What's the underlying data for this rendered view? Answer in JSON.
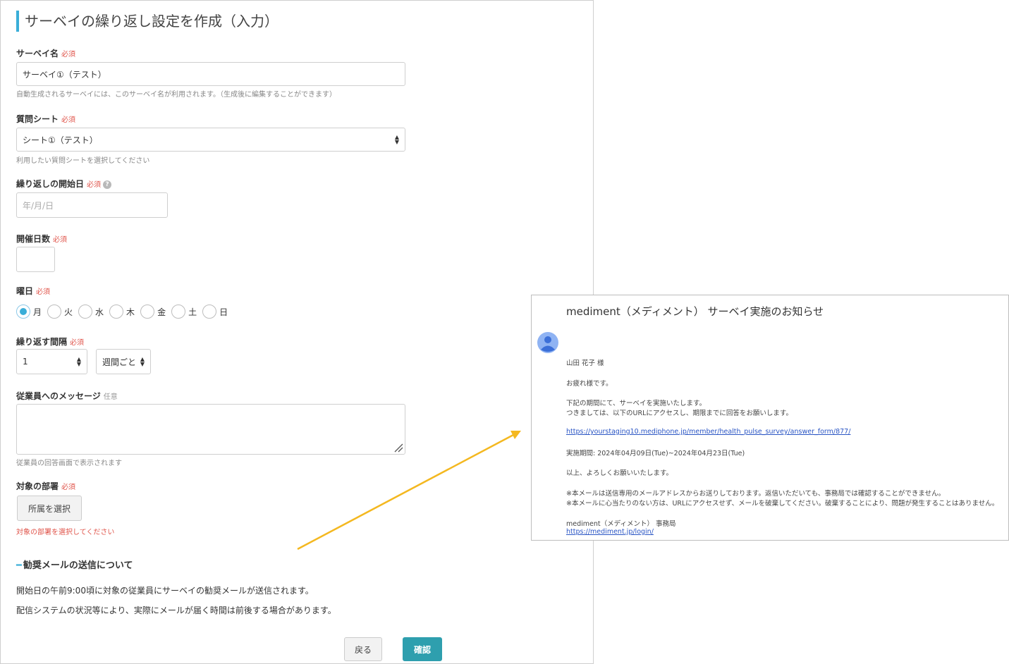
{
  "form": {
    "title": "サーベイの繰り返し設定を作成（入力）",
    "required_mark": "必須",
    "optional_mark": "任意",
    "survey_name": {
      "label": "サーベイ名",
      "value": "サーベイ①（テスト）",
      "hint": "自動生成されるサーベイには、このサーベイ名が利用されます。（生成後に編集することができます）"
    },
    "question_sheet": {
      "label": "質問シート",
      "selected": "シート①（テスト）",
      "hint": "利用したい質問シートを選択してください"
    },
    "start_date": {
      "label": "繰り返しの開始日",
      "placeholder": "年/月/日",
      "help_icon": "?"
    },
    "duration_days": {
      "label": "開催日数",
      "value": ""
    },
    "weekday": {
      "label": "曜日",
      "options": [
        "月",
        "火",
        "水",
        "木",
        "金",
        "土",
        "日"
      ],
      "selected": "月"
    },
    "interval": {
      "label": "繰り返す間隔",
      "value": "1",
      "unit": "週間ごと"
    },
    "message": {
      "label": "従業員へのメッセージ",
      "value": "",
      "hint": "従業員の回答画面で表示されます"
    },
    "department": {
      "label": "対象の部署",
      "button": "所属を選択",
      "error": "対象の部署を選択してください"
    },
    "mail_section": {
      "heading": "勧奨メールの送信について",
      "line1": "開始日の午前9:00頃に対象の従業員にサーベイの勧奨メールが送信されます。",
      "line2": "配信システムの状況等により、実際にメールが届く時間は前後する場合があります。"
    },
    "buttons": {
      "back": "戻る",
      "confirm": "確認"
    }
  },
  "email": {
    "subject": "mediment（メディメント） サーベイ実施のお知らせ",
    "greeting": "山田 花子 様",
    "opening": "お疲れ様です。",
    "body1": "下記の期間にて、サーベイを実施いたします。",
    "body2": "つきましては、以下のURLにアクセスし、期限までに回答をお願いします。",
    "survey_link": "https://yourstaging10.mediphone.jp/member/health_pulse_survey/answer_form/877/",
    "period": "実施期間: 2024年04月09日(Tue)~2024年04月23日(Tue)",
    "closing": "以上、よろしくお願いいたします。",
    "note1": "※本メールは送信専用のメールアドレスからお送りしております。返信いただいても、事務局では確認することができません。",
    "note2": "※本メールに心当たりのない方は、URLにアクセスせず、メールを破棄してください。破棄することにより、問題が発生することはありません。",
    "sender": "mediment（メディメント） 事務局",
    "sender_link": "https://mediment.jp/login/"
  },
  "colors": {
    "accent": "#3aaed8",
    "primary_button": "#2e9fae",
    "required": "#e0554b",
    "arrow": "#f4b820",
    "link": "#2a55c4"
  }
}
